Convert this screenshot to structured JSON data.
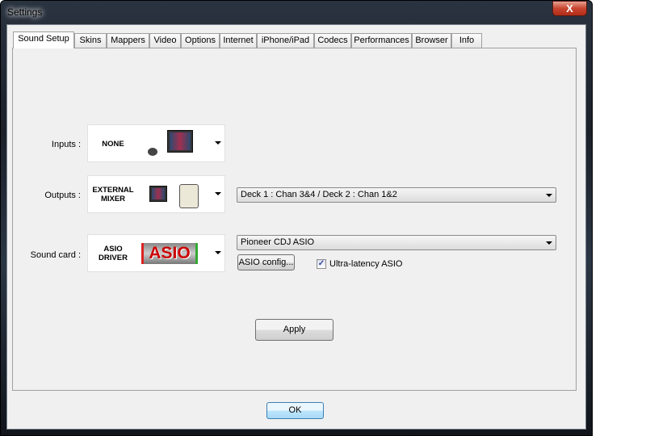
{
  "window": {
    "title": "Settings",
    "close_label": "X"
  },
  "tabs": [
    "Sound Setup",
    "Skins",
    "Mappers",
    "Video",
    "Options",
    "Internet",
    "iPhone/iPad",
    "Codecs",
    "Performances",
    "Browser",
    "Info"
  ],
  "active_tab": "Sound Setup",
  "inputs": {
    "label": "Inputs :",
    "value": "NONE"
  },
  "outputs": {
    "label": "Outputs :",
    "value_line1": "EXTERNAL",
    "value_line2": "MIXER",
    "routing": "Deck 1 : Chan 3&4 / Deck 2 : Chan 1&2"
  },
  "soundcard": {
    "label": "Sound card :",
    "value_line1": "ASIO",
    "value_line2": "DRIVER",
    "logo_text": "ASIO",
    "device": "Pioneer CDJ ASIO",
    "config_label": "ASIO config...",
    "ultra_latency_label": "Ultra-latency ASIO",
    "ultra_latency_checked": true
  },
  "apply_label": "Apply",
  "ok_label": "OK"
}
